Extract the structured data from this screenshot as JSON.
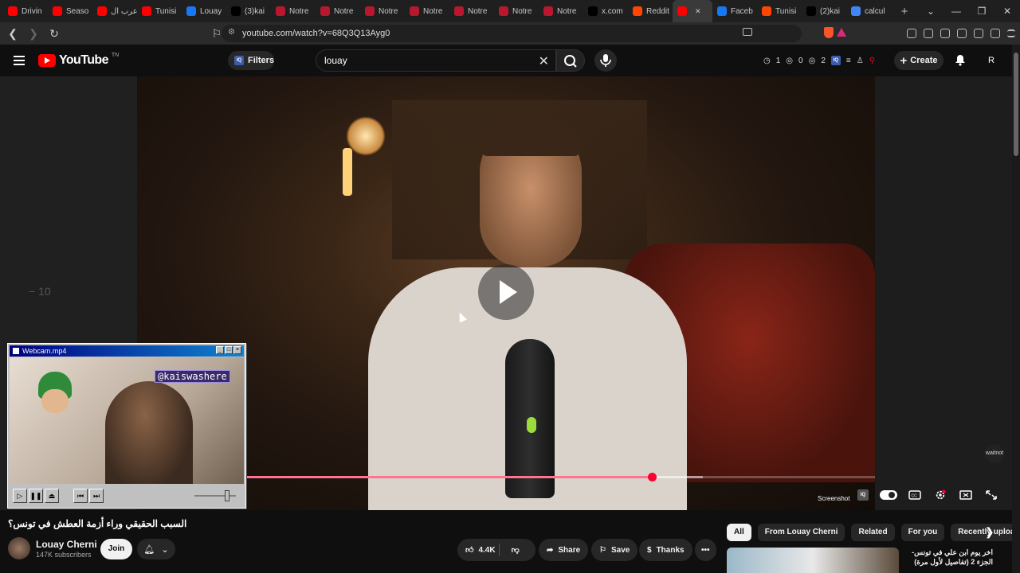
{
  "browser": {
    "tabs": [
      {
        "label": "Drivin",
        "color": "#ff0000"
      },
      {
        "label": "Seaso",
        "color": "#ff0000"
      },
      {
        "label": "عرب ال",
        "color": "#ff0000"
      },
      {
        "label": "Tunisi",
        "color": "#ff0000"
      },
      {
        "label": "Louay",
        "color": "#1877f2"
      },
      {
        "label": "(3)kai",
        "color": "#000000"
      },
      {
        "label": "Notre",
        "color": "#b8182e"
      },
      {
        "label": "Notre",
        "color": "#b8182e"
      },
      {
        "label": "Notre",
        "color": "#b8182e"
      },
      {
        "label": "Notre",
        "color": "#b8182e"
      },
      {
        "label": "Notre",
        "color": "#b8182e"
      },
      {
        "label": "Notre",
        "color": "#b8182e"
      },
      {
        "label": "Notre",
        "color": "#b8182e"
      },
      {
        "label": "x.com",
        "color": "#000000"
      },
      {
        "label": "Reddit",
        "color": "#ff4500"
      },
      {
        "label": "",
        "color": "#ff0000",
        "active": true
      },
      {
        "label": "Faceb",
        "color": "#1877f2"
      },
      {
        "label": "Tunisi",
        "color": "#ff4500"
      },
      {
        "label": "(2)kai",
        "color": "#000000"
      },
      {
        "label": "calcul",
        "color": "#4285f4"
      }
    ],
    "url": "youtube.com/watch?v=68Q3Q13Ayg0"
  },
  "header": {
    "logo_text": "YouTube",
    "logo_sup": "TN",
    "filters_label": "Filters",
    "search_value": "louay",
    "stat1": "1",
    "stat2": "0",
    "stat3": "2",
    "create_label": "Create",
    "avatar_letter": "R"
  },
  "player": {
    "seek_back_label": "− 10",
    "screenshot_label": "Screenshot",
    "progress_fraction": 0.645,
    "buffered_fraction": 0.726,
    "watermark": "waitnot"
  },
  "webcam": {
    "title": "Webcam.mp4",
    "handle": "@kaiswashere"
  },
  "video": {
    "title": "السبب الحقيقي وراء أزمة العطش في تونس؟",
    "channel": "Louay Cherni",
    "subscribers": "147K subscribers",
    "join_label": "Join",
    "likes": "4.4K",
    "share_label": "Share",
    "save_label": "Save",
    "thanks_label": "Thanks"
  },
  "sidebar": {
    "chips": [
      "All",
      "From Louay Cherni",
      "Related",
      "For you",
      "Recently uploa"
    ],
    "related_title": "اخر يوم ابن علي في تونس- الجزء 2 (تفاصيل لأول مرة)"
  }
}
